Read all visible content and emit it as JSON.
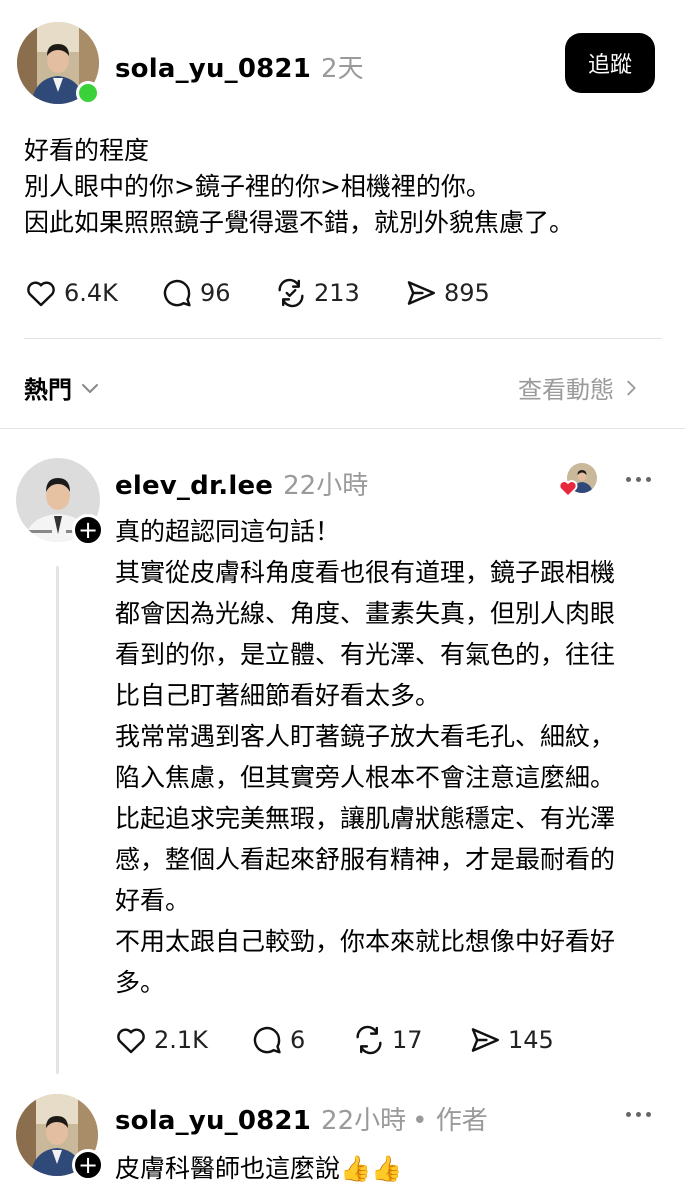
{
  "post": {
    "username": "sola_yu_0821",
    "time": "2天",
    "follow_label": "追蹤",
    "lines": [
      "好看的程度",
      "別人眼中的你>鏡子裡的你>相機裡的你。",
      "因此如果照照鏡子覺得還不錯，就別外貌焦慮了。"
    ],
    "likes": "6.4K",
    "comments": "96",
    "reposts": "213",
    "shares": "895"
  },
  "sort": {
    "label": "熱門",
    "view_activity": "查看動態"
  },
  "reply1": {
    "username": "elev_dr.lee",
    "time": "22小時",
    "lines": [
      "真的超認同這句話！",
      "其實從皮膚科角度看也很有道理，鏡子跟相機",
      "都會因為光線、角度、畫素失真，但別人肉眼",
      "看到的你，是立體、有光澤、有氣色的，往往",
      "比自己盯著細節看好看太多。",
      "我常常遇到客人盯著鏡子放大看毛孔、細紋，",
      "陷入焦慮，但其實旁人根本不會注意這麼細。",
      "比起追求完美無瑕，讓肌膚狀態穩定、有光澤",
      "感，整個人看起來舒服有精神，才是最耐看的",
      "好看。",
      "不用太跟自己較勁，你本來就比想像中好看好",
      "多。"
    ],
    "likes": "2.1K",
    "comments": "6",
    "reposts": "17",
    "shares": "145"
  },
  "reply2": {
    "username": "sola_yu_0821",
    "time": "22小時",
    "author_tag": "• 作者",
    "text": "皮膚科醫師也這麼說👍👍"
  },
  "colors": {
    "online": "#3bd13b",
    "heart": "#e8283c",
    "muted": "#9a9a9a"
  }
}
